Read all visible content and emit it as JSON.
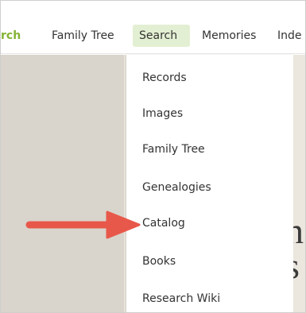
{
  "nav": {
    "brand_text": "rch",
    "items": [
      {
        "label": "Family Tree"
      },
      {
        "label": "Search"
      },
      {
        "label": "Memories"
      },
      {
        "label": "Inde"
      }
    ]
  },
  "search_menu": {
    "items": [
      {
        "label": "Records"
      },
      {
        "label": "Images"
      },
      {
        "label": "Family Tree"
      },
      {
        "label": "Genealogies"
      },
      {
        "label": "Catalog"
      },
      {
        "label": "Books"
      },
      {
        "label": "Research Wiki"
      }
    ]
  },
  "hero": {
    "glyph_line1": "n",
    "glyph_line2": "s"
  },
  "colors": {
    "brand": "#84b234",
    "active_tab_bg": "#e3efd2",
    "arrow": "#e8584a"
  },
  "annotation": {
    "icon": "red-arrow-icon"
  }
}
